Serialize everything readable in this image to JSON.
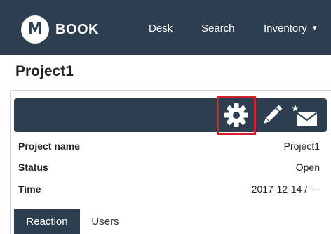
{
  "navbar": {
    "logo_letter": "M",
    "brand": "BOOK",
    "links": [
      "Desk",
      "Search",
      "Inventory"
    ]
  },
  "page": {
    "title": "Project1"
  },
  "toolbar": {
    "icons": [
      "gear-icon",
      "pencil-icon",
      "envelope-star-icon"
    ]
  },
  "details": [
    {
      "label": "Project name",
      "value": "Project1"
    },
    {
      "label": "Status",
      "value": "Open"
    },
    {
      "label": "Time",
      "value": "2017-12-14 / ---"
    }
  ],
  "tabs": [
    {
      "label": "Reaction",
      "active": true
    },
    {
      "label": "Users",
      "active": false
    }
  ],
  "colors": {
    "navbar": "#2c3e4f",
    "highlight": "#d01f2a"
  }
}
